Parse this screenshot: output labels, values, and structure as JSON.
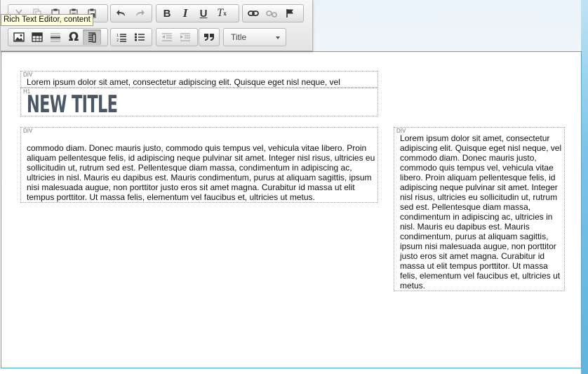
{
  "tooltip": "Rich Text Editor, content",
  "toolbar": {
    "format_select": "Title",
    "buttons": {
      "bold": "B",
      "italic": "I",
      "underline": "U",
      "remove_format": "T",
      "remove_format_sub": "x",
      "special_char": "Ω"
    },
    "icons": [
      "cut-icon",
      "copy-icon",
      "paste-icon",
      "paste-text-icon",
      "paste-word-icon",
      "undo-icon",
      "redo-icon",
      "link-icon",
      "unlink-icon",
      "anchor-icon",
      "image-icon",
      "table-icon",
      "horizontal-rule-icon",
      "special-char-icon",
      "show-blocks-icon",
      "numbered-list-icon",
      "bulleted-list-icon",
      "outdent-icon",
      "indent-icon",
      "blockquote-icon"
    ]
  },
  "content": {
    "div1": {
      "tag": "DIV",
      "text": "Lorem ipsum dolor sit amet, consectetur adipiscing elit. Quisque eget nisl neque, vel"
    },
    "h1": {
      "tag": "H1",
      "text": "NEW TITLE"
    },
    "div2": {
      "tag": "DIV",
      "text": "commodo diam. Donec mauris justo, commodo quis tempus vel, vehicula vitae libero. Proin aliquam pellentesque felis, id adipiscing neque pulvinar sit amet. Integer nisl risus, ultricies eu sollicitudin ut, rutrum sed est. Pellentesque diam massa, condimentum in adipiscing ac, ultricies in nisl. Mauris eu dapibus est. Mauris condimentum, purus at aliquam sagittis, ipsum nisi malesuada augue, non porttitor justo eros sit amet magna. Curabitur id massa ut elit tempus porttitor. Ut massa felis, elementum vel faucibus et, ultricies ut metus."
    },
    "div3": {
      "tag": "DIV",
      "text": "Lorem ipsum dolor sit amet, consectetur adipiscing elit. Quisque eget nisl neque, vel commodo diam. Donec mauris justo, commodo quis tempus vel, vehicula vitae libero. Proin aliquam pellentesque felis, id adipiscing neque pulvinar sit amet. Integer nisl risus, ultricies eu sollicitudin ut, rutrum sed est. Pellentesque diam massa, condimentum in adipiscing ac, ultricies in nisl. Mauris eu dapibus est. Mauris condimentum, purus at aliquam sagittis, ipsum nisi malesuada augue, non porttitor justo eros sit amet magna. Curabitur id massa ut elit tempus porttitor. Ut massa felis, elementum vel faucibus et, ultricies ut metus."
    }
  },
  "colors": {
    "editor_border": "#4aa6cf",
    "title_color": "#4a5866",
    "tooltip_bg": "#ffffd9"
  }
}
